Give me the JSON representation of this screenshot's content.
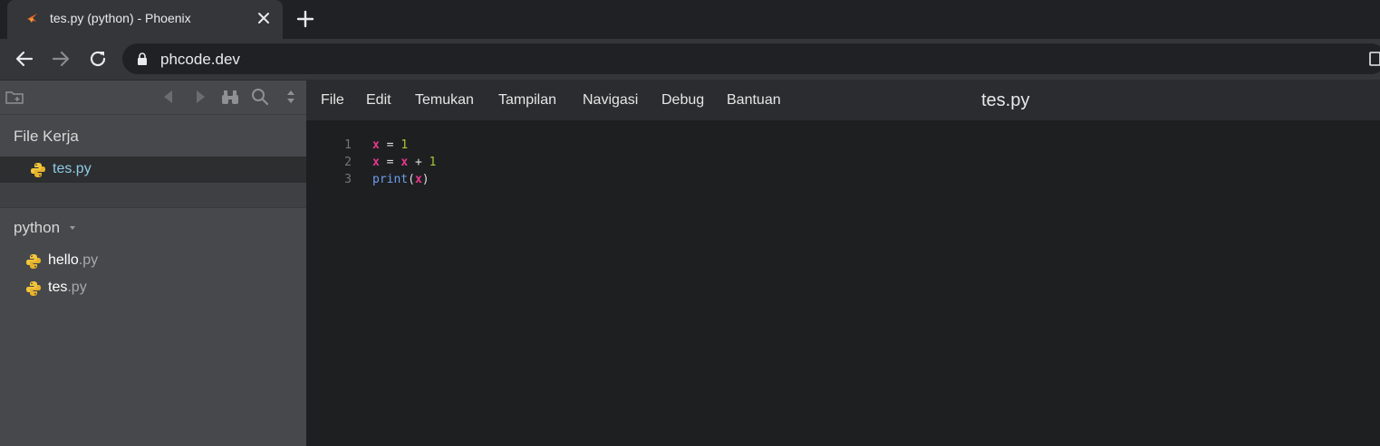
{
  "browser": {
    "tab_title": "tes.py (python) - Phoenix",
    "url": "phcode.dev",
    "icons": {
      "favicon": "phoenix-favicon-icon",
      "close": "close-icon",
      "new_tab": "plus-icon",
      "back": "arrow-left-icon",
      "forward": "arrow-right-icon",
      "reload": "reload-icon",
      "lock": "lock-icon"
    }
  },
  "sidebar": {
    "toolbar_icons": [
      "new-folder-icon",
      "navigate-back-icon",
      "navigate-forward-icon",
      "binoculars-icon",
      "search-icon",
      "sort-icon"
    ],
    "working_files_title": "File Kerja",
    "working_files": [
      {
        "name": "tes.py"
      }
    ],
    "project_title": "python",
    "project_files": [
      {
        "base": "hello",
        "ext": ".py"
      },
      {
        "base": "tes",
        "ext": ".py"
      }
    ]
  },
  "menubar": {
    "items": [
      "File",
      "Edit",
      "Temukan",
      "Tampilan",
      "Navigasi",
      "Debug",
      "Bantuan"
    ],
    "document_title": "tes.py"
  },
  "editor": {
    "lines": [
      {
        "number": "1",
        "tokens": [
          {
            "t": "x",
            "k": "var"
          },
          {
            "t": " = ",
            "k": "op"
          },
          {
            "t": "1",
            "k": "num"
          }
        ]
      },
      {
        "number": "2",
        "tokens": [
          {
            "t": "x",
            "k": "var"
          },
          {
            "t": " = ",
            "k": "op"
          },
          {
            "t": "x",
            "k": "var"
          },
          {
            "t": " + ",
            "k": "op"
          },
          {
            "t": "1",
            "k": "num"
          }
        ]
      },
      {
        "number": "3",
        "tokens": [
          {
            "t": "print",
            "k": "fn"
          },
          {
            "t": "(",
            "k": "punc"
          },
          {
            "t": "x",
            "k": "var"
          },
          {
            "t": ")",
            "k": "punc"
          }
        ]
      }
    ]
  },
  "colors": {
    "variable": "#e8398f",
    "number": "#a3c739",
    "builtin": "#6c9fee",
    "sidebar_bg": "#47484b",
    "editor_bg": "#1e1f21",
    "selected_file": "#8ecae6"
  }
}
